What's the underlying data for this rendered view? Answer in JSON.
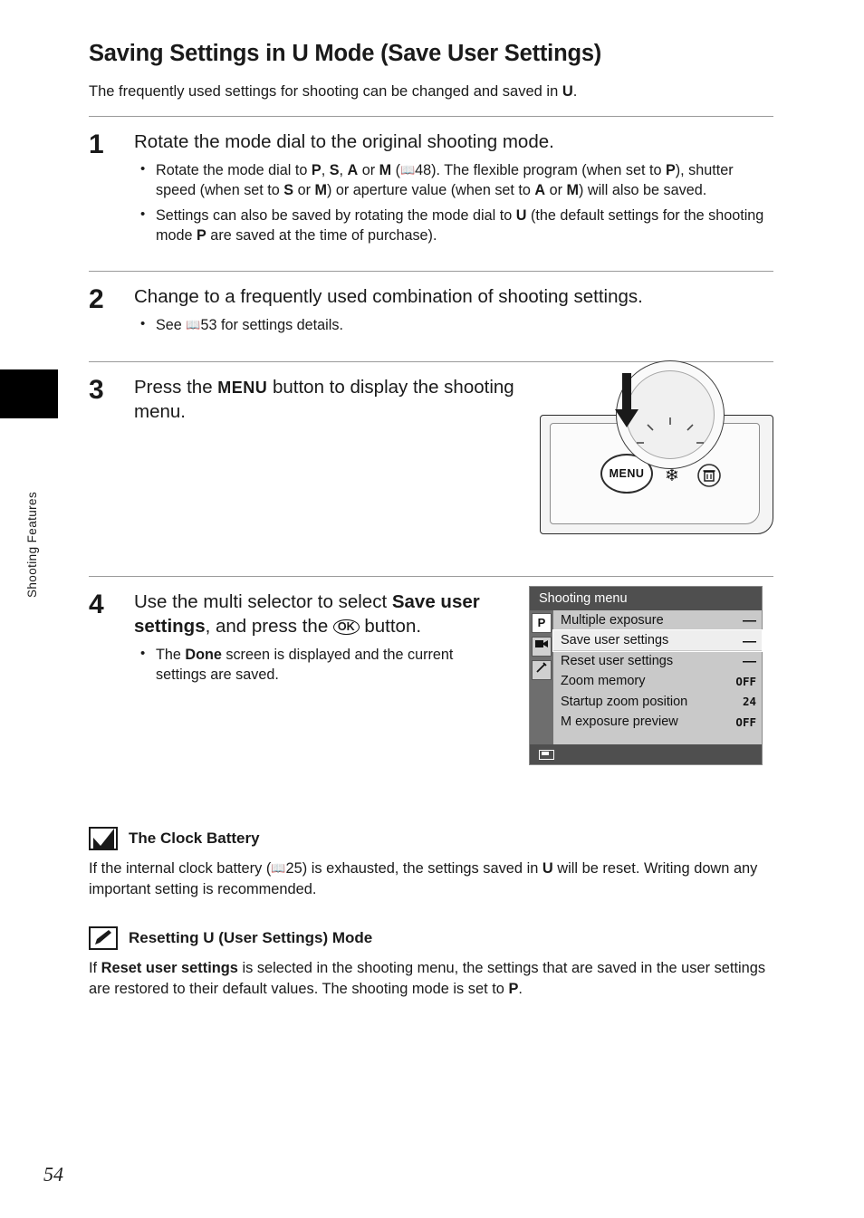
{
  "page": {
    "number": "54",
    "side_label": "Shooting Features"
  },
  "header": {
    "title_part1": "Saving Settings in ",
    "title_u": "U",
    "title_part2": " Mode (Save User Settings)",
    "intro_part1": "The frequently used settings for shooting can be changed and saved in ",
    "intro_u": "U",
    "intro_part2": "."
  },
  "steps": [
    {
      "num": "1",
      "heading": "Rotate the mode dial to the original shooting mode.",
      "bullets": [
        "Rotate the mode dial to P, S, A or M (A48). The flexible program (when set to P), shutter speed (when set to S or M) or aperture value (when set to A or M) will also be saved.",
        "Settings can also be saved by rotating the mode dial to U (the default settings for the shooting mode P are saved at the time of purchase)."
      ]
    },
    {
      "num": "2",
      "heading": "Change to a frequently used combination of shooting settings.",
      "bullets": [
        "See A53 for settings details."
      ]
    },
    {
      "num": "3",
      "heading_part1": "Press the ",
      "heading_menu": "MENU",
      "heading_part2": " button to display the shooting menu.",
      "bullets": []
    },
    {
      "num": "4",
      "heading_part1": "Use the multi selector to select ",
      "heading_bold": "Save user settings",
      "heading_part2": ", and press the ",
      "heading_ok": "OK",
      "heading_part3": " button.",
      "bullets": [
        "The Done screen is displayed and the current settings are saved."
      ]
    }
  ],
  "camera_figure": {
    "menu_button_label": "MENU",
    "flower_icon": "macro-flower-icon",
    "trash_icon": "delete-trash-icon",
    "arrow_icon": "down-arrow-icon"
  },
  "lcd": {
    "title": "Shooting menu",
    "tabs": [
      {
        "glyph": "P",
        "name": "shooting-tab"
      },
      {
        "glyph": "☉",
        "name": "movie-tab"
      },
      {
        "glyph": "⚙",
        "name": "setup-tab"
      }
    ],
    "rows": [
      {
        "label": "Multiple exposure",
        "value": "––",
        "highlight": false
      },
      {
        "label": "Save user settings",
        "value": "––",
        "highlight": true
      },
      {
        "label": "Reset user settings",
        "value": "––",
        "highlight": false
      },
      {
        "label": "Zoom memory",
        "value": "OFF",
        "highlight": false
      },
      {
        "label": "Startup zoom position",
        "value": "24",
        "highlight": false
      },
      {
        "label": "M exposure preview",
        "value": "OFF",
        "highlight": false
      }
    ]
  },
  "notes": [
    {
      "icon": "checkmark-note-icon",
      "title": "The Clock Battery",
      "body_part1": "If the internal clock battery (",
      "body_ref": "A25",
      "body_part2": ") is exhausted, the settings saved in ",
      "body_u": "U",
      "body_part3": " will be reset. Writing down any important setting is recommended."
    },
    {
      "icon": "pencil-note-icon",
      "title_part1": "Resetting ",
      "title_u": "U",
      "title_part2": " (User Settings) Mode",
      "body_part1": "If ",
      "body_bold": "Reset user settings",
      "body_part2": " is selected in the shooting menu, the settings that are saved in the user settings are restored to their default values. The shooting mode is set to ",
      "body_mode": "P",
      "body_part3": "."
    }
  ],
  "colors": {
    "text": "#1a1a1a",
    "rule": "#9a9a9a",
    "lcd_title_bg": "#4f4f4f",
    "lcd_body_bg": "#c9c9c9",
    "lcd_highlight": "#eeeeee"
  }
}
